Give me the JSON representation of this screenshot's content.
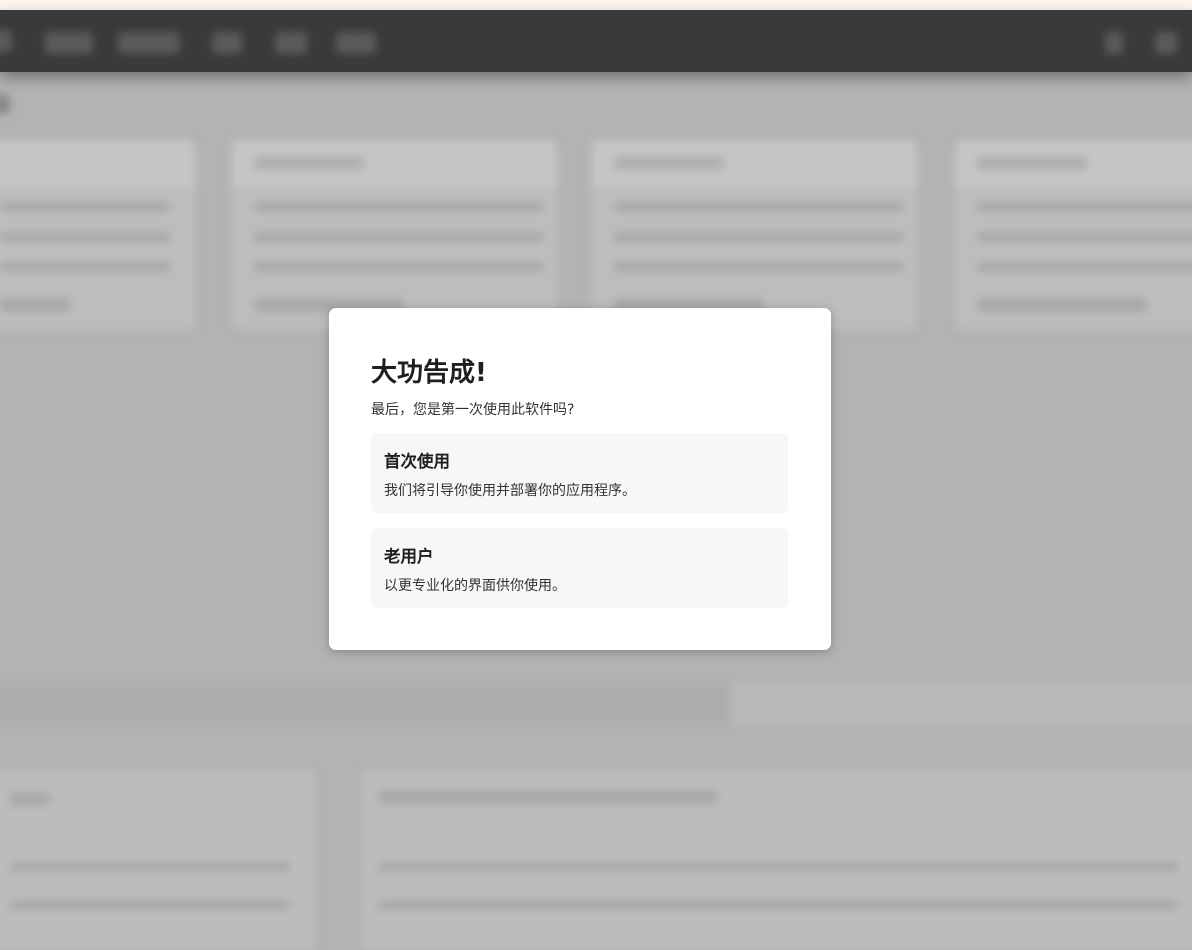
{
  "dialog": {
    "title": "大功告成!",
    "subtitle": "最后，您是第一次使用此软件吗?",
    "options": [
      {
        "title": "首次使用",
        "description": "我们将引导你使用并部署你的应用程序。"
      },
      {
        "title": "老用户",
        "description": "以更专业化的界面供你使用。"
      }
    ]
  }
}
